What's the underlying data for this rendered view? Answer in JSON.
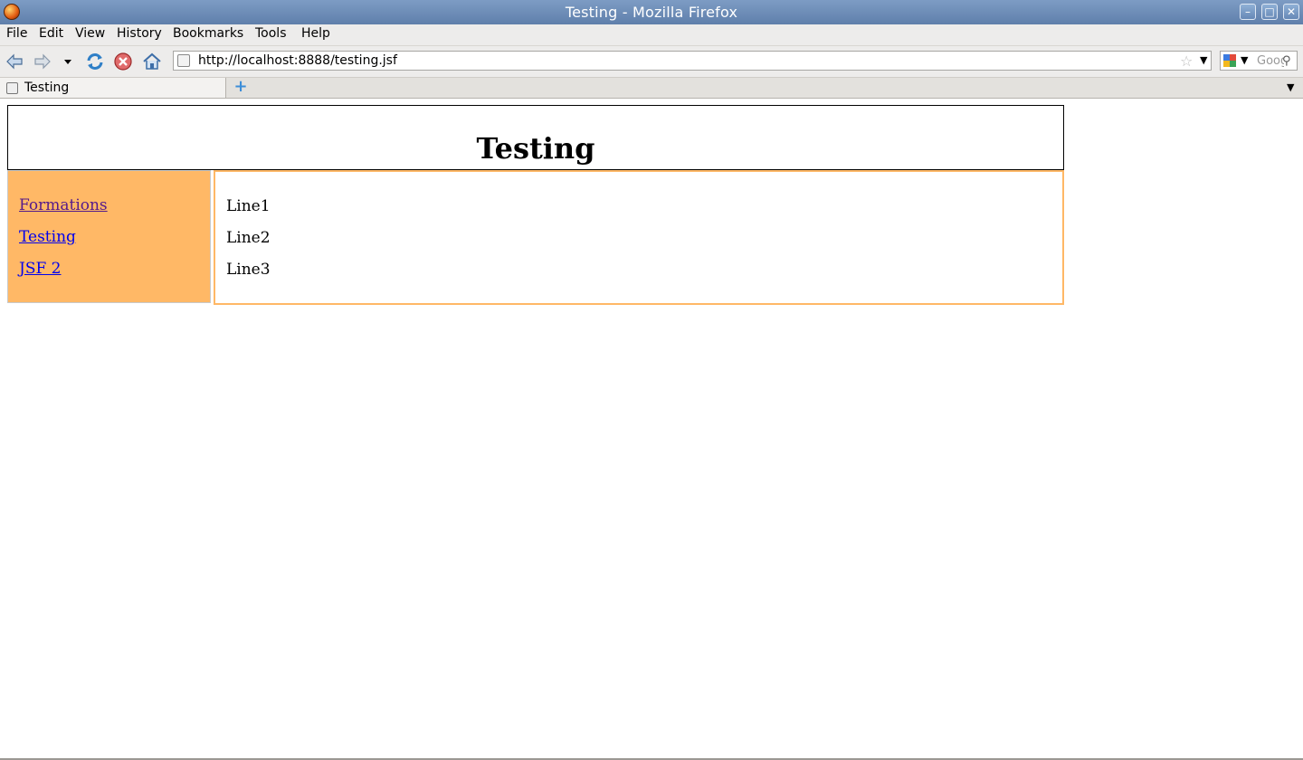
{
  "window": {
    "title": "Testing - Mozilla Firefox"
  },
  "menubar": {
    "items": [
      "File",
      "Edit",
      "View",
      "History",
      "Bookmarks",
      "Tools",
      "Help"
    ]
  },
  "navbar": {
    "url": "http://localhost:8888/testing.jsf",
    "search_placeholder": "Google"
  },
  "tabs": [
    {
      "label": "Testing"
    }
  ],
  "page": {
    "heading": "Testing",
    "nav_links": [
      {
        "label": "Formations",
        "state": "visited"
      },
      {
        "label": "Testing",
        "state": "link"
      },
      {
        "label": "JSF 2",
        "state": "link"
      }
    ],
    "lines": [
      "Line1",
      "Line2",
      "Line3"
    ]
  },
  "colors": {
    "accent_orange": "#ffb866",
    "link": "#0000ee",
    "visited_link": "#551a8b",
    "titlebar": "#6b8bb6"
  },
  "icons": [
    "firefox-icon",
    "back-icon",
    "forward-icon",
    "history-dropdown-icon",
    "reload-icon",
    "stop-icon",
    "home-icon",
    "page-icon",
    "bookmark-star-icon",
    "google-icon",
    "search-icon",
    "new-tab-icon",
    "tab-list-icon"
  ]
}
